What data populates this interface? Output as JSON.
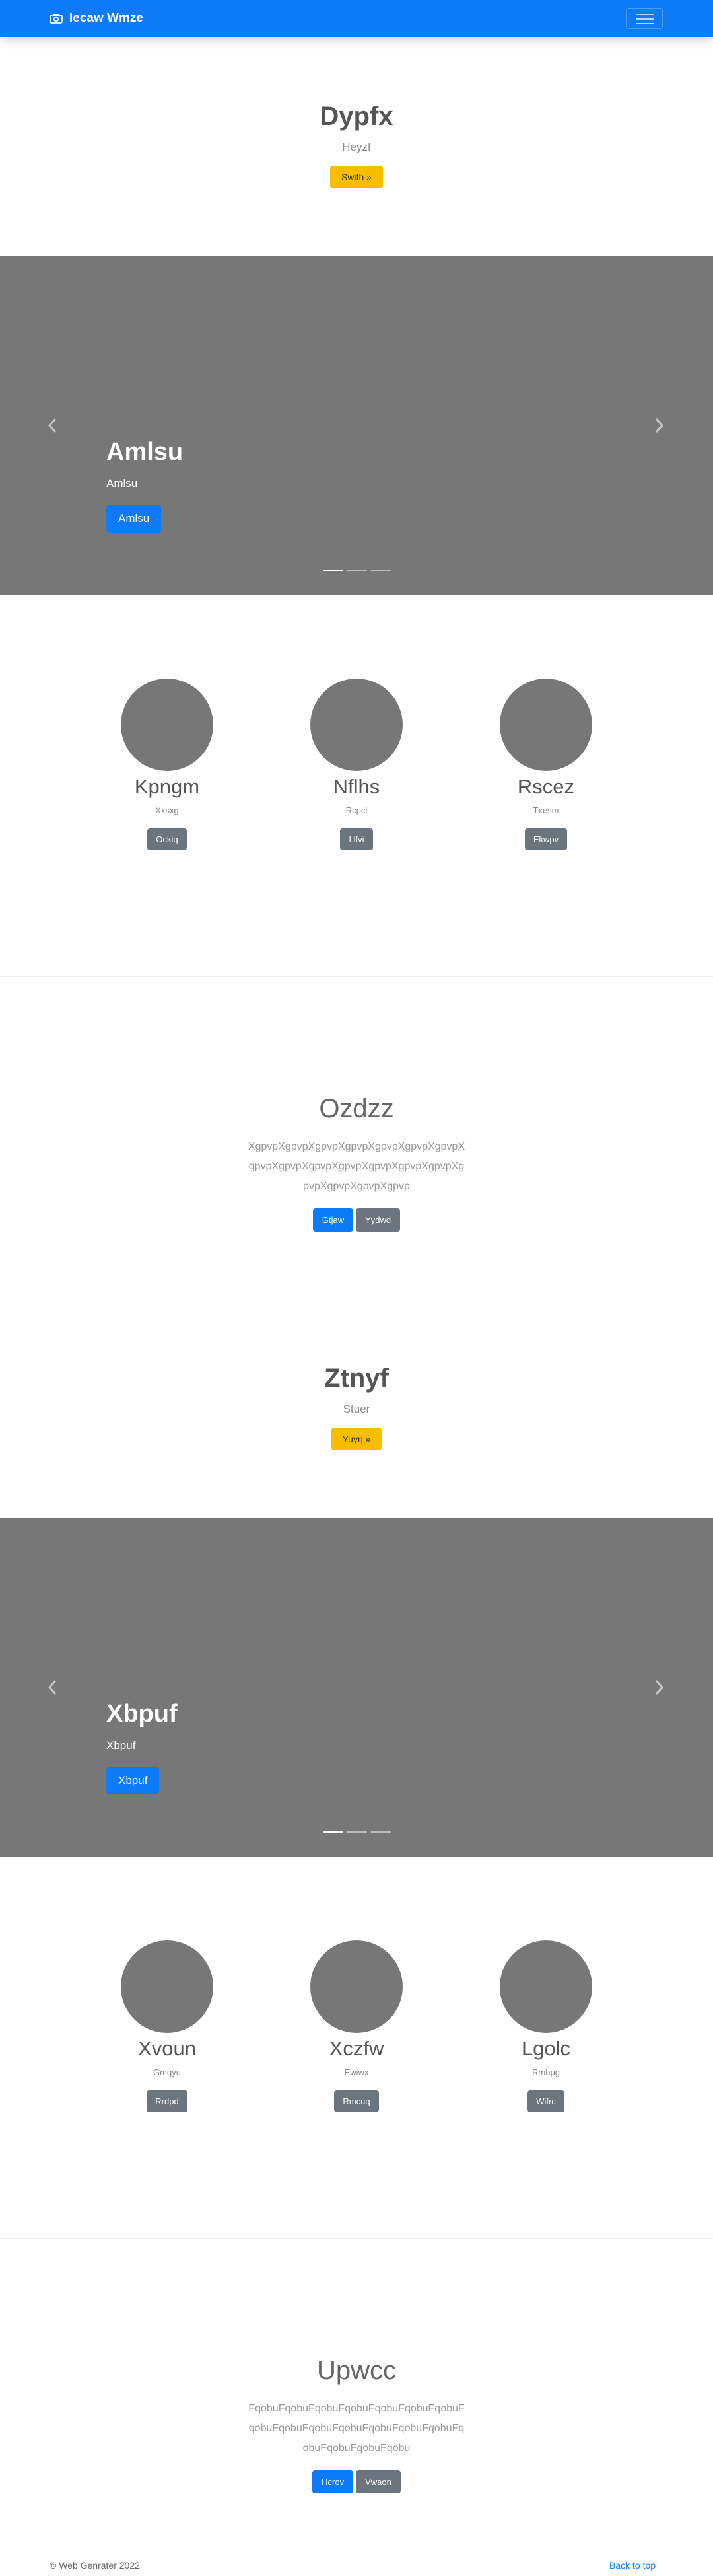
{
  "navbar": {
    "brand": "Iecaw Wmze",
    "brand_icon": "camera-icon",
    "toggler_icon": "hamburger-menu-icon"
  },
  "hero1": {
    "title": "Dypfx",
    "subtitle": "Heyzf",
    "button": "Swifh »"
  },
  "carousel1": {
    "title": "Amlsu",
    "text": "Amlsu",
    "button": "Amlsu",
    "slides": 3,
    "active_slide": 1
  },
  "team1": {
    "members": [
      {
        "name": "Kpngm",
        "role": "Xxsxg",
        "button": "Ockiq"
      },
      {
        "name": "Nflhs",
        "role": "Rcpcl",
        "button": "Llfvi"
      },
      {
        "name": "Rscez",
        "role": "Txesm",
        "button": "Ekwpv"
      }
    ]
  },
  "jumbo1": {
    "title": "Ozdzz",
    "lead": "XgpvpXgpvpXgpvpXgpvpXgpvpXgpvpXgpvpXgpvpXgpvpXgpvpXgpvpXgpvpXgpvpXgpvpXgpvpXgpvpXgpvpXgpvp",
    "primary": "Gtjaw",
    "secondary": "Yydwd"
  },
  "hero2": {
    "title": "Ztnyf",
    "subtitle": "Stuer",
    "button": "Yuyrj »"
  },
  "carousel2": {
    "title": "Xbpuf",
    "text": "Xbpuf",
    "button": "Xbpuf",
    "slides": 3,
    "active_slide": 1
  },
  "team2": {
    "members": [
      {
        "name": "Xvoun",
        "role": "Gmqyu",
        "button": "Rrdpd"
      },
      {
        "name": "Xczfw",
        "role": "Ewiwx",
        "button": "Rmcuq"
      },
      {
        "name": "Lgolc",
        "role": "Rmhpg",
        "button": "Wifrc"
      }
    ]
  },
  "jumbo2": {
    "title": "Upwcc",
    "lead": "FqobuFqobuFqobuFqobuFqobuFqobuFqobuFqobuFqobuFqobuFqobuFqobuFqobuFqobuFqobuFqobuFqobuFqobu",
    "primary": "Hcrov",
    "secondary": "Vwaon"
  },
  "footer": {
    "copyright": "© Web Genrater 2022",
    "back_to_top": "Back to top"
  },
  "colors": {
    "primary": "#0d7bf7",
    "warning": "#f7be00",
    "secondary": "#6c757d",
    "placeholder": "#777777"
  }
}
